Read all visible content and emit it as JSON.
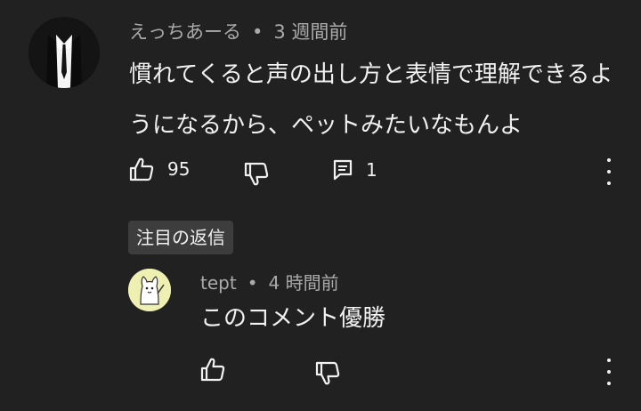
{
  "comment": {
    "author": "えっちあーる",
    "separator": "•",
    "time": "3 週間前",
    "text": "慣れてくると声の出し方と表情で理解できるようになるから、ペットみたいなもんよ",
    "like_count": "95",
    "reply_count": "1"
  },
  "filter_chip": "注目の返信",
  "reply": {
    "author": "tept",
    "separator": "•",
    "time": "4 時間前",
    "text": "このコメント優勝"
  },
  "colors": {
    "background": "#212121",
    "text_primary": "#f1f1f1",
    "text_secondary": "#aaaaaa",
    "chip_bg": "#3d3d3d"
  },
  "icons": {
    "like": "thumb-up-icon",
    "dislike": "thumb-down-icon",
    "reply": "comment-icon",
    "more": "more-vert-icon"
  }
}
